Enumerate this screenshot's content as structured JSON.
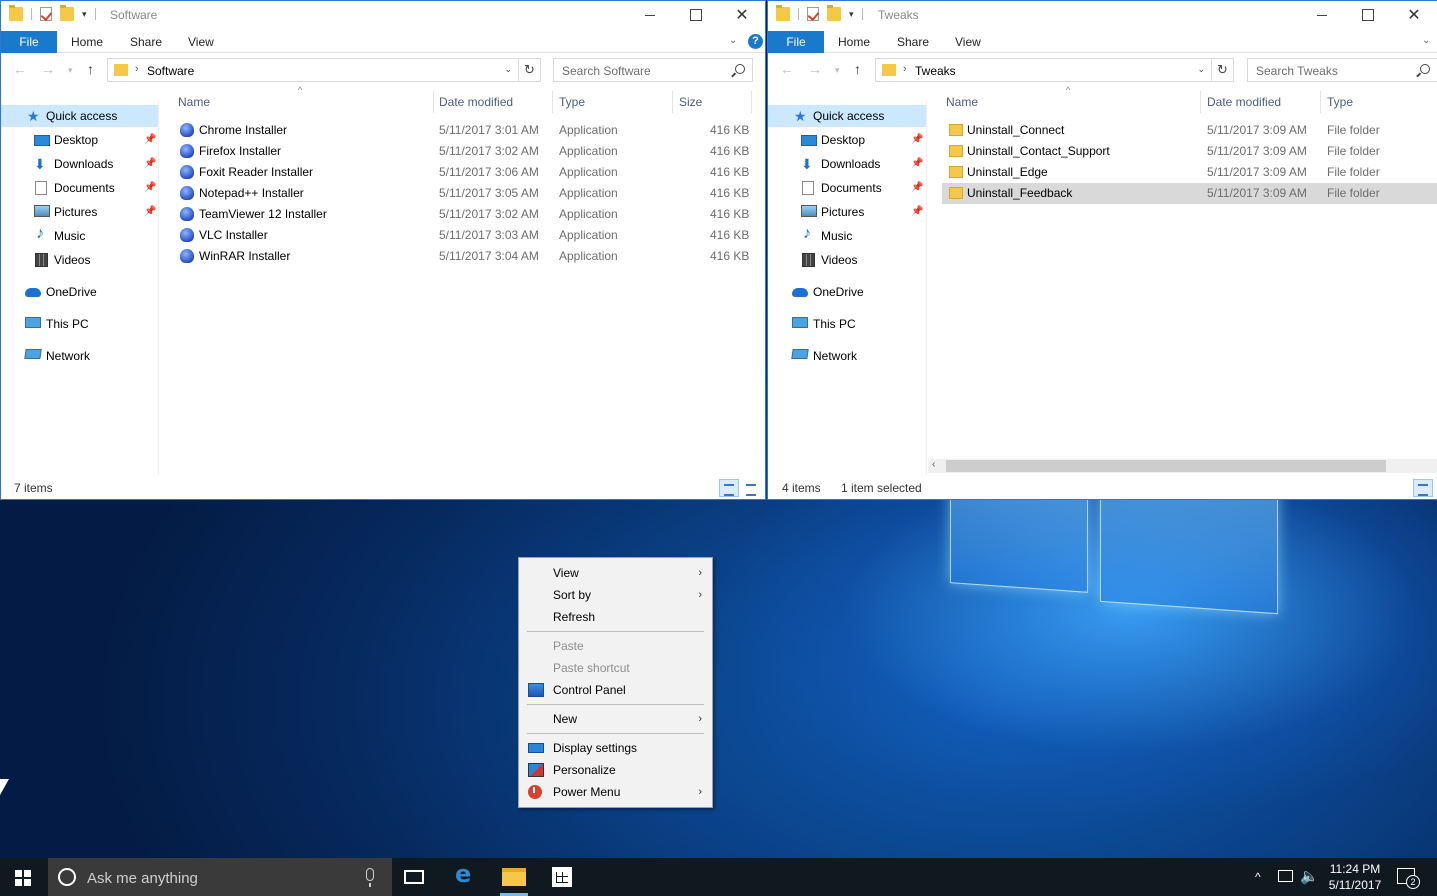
{
  "colors": {
    "accent": "#1979ca",
    "selection_nav": "#cce8ff",
    "selection_row": "#d9d9d9",
    "taskbar": "#101820",
    "menu_bg": "#f2f2f2"
  },
  "left_window": {
    "title": "Software",
    "tabs": [
      "File",
      "Home",
      "Share",
      "View"
    ],
    "address": "Software",
    "search_placeholder": "Search Software",
    "columns": [
      "Name",
      "Date modified",
      "Type",
      "Size"
    ],
    "nav": [
      {
        "label": "Quick access",
        "icon": "star-icon"
      },
      {
        "label": "Desktop",
        "icon": "desktop-icon"
      },
      {
        "label": "Downloads",
        "icon": "download-icon"
      },
      {
        "label": "Documents",
        "icon": "documents-icon"
      },
      {
        "label": "Pictures",
        "icon": "pictures-icon"
      },
      {
        "label": "Music",
        "icon": "music-icon"
      },
      {
        "label": "Videos",
        "icon": "videos-icon"
      },
      {
        "label": "OneDrive",
        "icon": "onedrive-icon"
      },
      {
        "label": "This PC",
        "icon": "this-pc-icon"
      },
      {
        "label": "Network",
        "icon": "network-icon"
      }
    ],
    "files": [
      {
        "name": "Chrome Installer",
        "date": "5/11/2017 3:01 AM",
        "type": "Application",
        "size": "416 KB"
      },
      {
        "name": "Firefox Installer",
        "date": "5/11/2017 3:02 AM",
        "type": "Application",
        "size": "416 KB"
      },
      {
        "name": "Foxit Reader Installer",
        "date": "5/11/2017 3:06 AM",
        "type": "Application",
        "size": "416 KB"
      },
      {
        "name": "Notepad++ Installer",
        "date": "5/11/2017 3:05 AM",
        "type": "Application",
        "size": "416 KB"
      },
      {
        "name": "TeamViewer 12 Installer",
        "date": "5/11/2017 3:02 AM",
        "type": "Application",
        "size": "416 KB"
      },
      {
        "name": "VLC Installer",
        "date": "5/11/2017 3:03 AM",
        "type": "Application",
        "size": "416 KB"
      },
      {
        "name": "WinRAR Installer",
        "date": "5/11/2017 3:04 AM",
        "type": "Application",
        "size": "416 KB"
      }
    ],
    "status": "7 items"
  },
  "right_window": {
    "title": "Tweaks",
    "tabs": [
      "File",
      "Home",
      "Share",
      "View"
    ],
    "address": "Tweaks",
    "search_placeholder": "Search Tweaks",
    "columns": [
      "Name",
      "Date modified",
      "Type"
    ],
    "nav": [
      {
        "label": "Quick access",
        "icon": "star-icon"
      },
      {
        "label": "Desktop",
        "icon": "desktop-icon"
      },
      {
        "label": "Downloads",
        "icon": "download-icon"
      },
      {
        "label": "Documents",
        "icon": "documents-icon"
      },
      {
        "label": "Pictures",
        "icon": "pictures-icon"
      },
      {
        "label": "Music",
        "icon": "music-icon"
      },
      {
        "label": "Videos",
        "icon": "videos-icon"
      },
      {
        "label": "OneDrive",
        "icon": "onedrive-icon"
      },
      {
        "label": "This PC",
        "icon": "this-pc-icon"
      },
      {
        "label": "Network",
        "icon": "network-icon"
      }
    ],
    "files": [
      {
        "name": "Uninstall_Connect",
        "date": "5/11/2017 3:09 AM",
        "type": "File folder"
      },
      {
        "name": "Uninstall_Contact_Support",
        "date": "5/11/2017 3:09 AM",
        "type": "File folder"
      },
      {
        "name": "Uninstall_Edge",
        "date": "5/11/2017 3:09 AM",
        "type": "File folder"
      },
      {
        "name": "Uninstall_Feedback",
        "date": "5/11/2017 3:09 AM",
        "type": "File folder",
        "selected": true
      }
    ],
    "status_count": "4 items",
    "status_selected": "1 item selected"
  },
  "context_menu": {
    "items": [
      {
        "label": "View",
        "submenu": true
      },
      {
        "label": "Sort by",
        "submenu": true
      },
      {
        "label": "Refresh"
      },
      {
        "label": "Paste",
        "disabled": true
      },
      {
        "label": "Paste shortcut",
        "disabled": true
      },
      {
        "label": "Control Panel",
        "icon": "control-panel-icon"
      },
      {
        "label": "New",
        "submenu": true
      },
      {
        "label": "Display settings",
        "icon": "display-icon"
      },
      {
        "label": "Personalize",
        "icon": "personalize-icon"
      },
      {
        "label": "Power Menu",
        "icon": "power-icon",
        "submenu": true
      }
    ]
  },
  "taskbar": {
    "search_placeholder": "Ask me anything",
    "time": "11:24 PM",
    "date": "5/11/2017",
    "notification_count": "2"
  }
}
